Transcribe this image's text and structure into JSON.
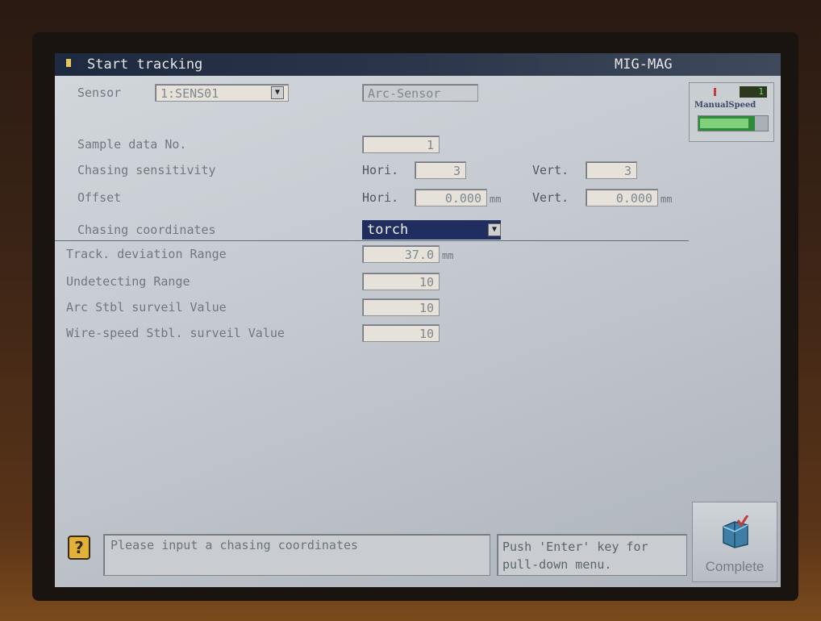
{
  "titlebar": {
    "title": "Start tracking",
    "mode": "MIG-MAG"
  },
  "sensor": {
    "label": "Sensor",
    "value": "1:SENS01",
    "type": "Arc-Sensor"
  },
  "manual_speed": {
    "label": "ManualSpeed",
    "value": "1"
  },
  "settings": {
    "sample_data": {
      "label": "Sample data No.",
      "value": "1"
    },
    "chasing_sensitivity": {
      "label": "Chasing sensitivity",
      "hori_label": "Hori.",
      "hori_value": "3",
      "vert_label": "Vert.",
      "vert_value": "3"
    },
    "offset": {
      "label": "Offset",
      "hori_label": "Hori.",
      "hori_value": "0.000",
      "hori_unit": "mm",
      "vert_label": "Vert.",
      "vert_value": "0.000",
      "vert_unit": "mm"
    },
    "chasing_coordinates": {
      "label": "Chasing coordinates",
      "value": "torch"
    },
    "track_deviation": {
      "label": "Track. deviation Range",
      "value": "37.0",
      "unit": "mm"
    },
    "undetecting_range": {
      "label": "Undetecting Range",
      "value": "10"
    },
    "arc_stbl": {
      "label": "Arc Stbl surveil Value",
      "value": "10"
    },
    "wire_speed_stbl": {
      "label": "Wire-speed Stbl. surveil Value",
      "value": "10"
    }
  },
  "footer": {
    "message": "Please input a chasing coordinates",
    "hint_line1": "Push 'Enter' key for",
    "hint_line2": "pull-down menu.",
    "complete_label": "Complete"
  },
  "colors": {
    "accent": "#1f2e5e",
    "titlebar": "#1e2a40",
    "screen": "#c9cdd1"
  }
}
